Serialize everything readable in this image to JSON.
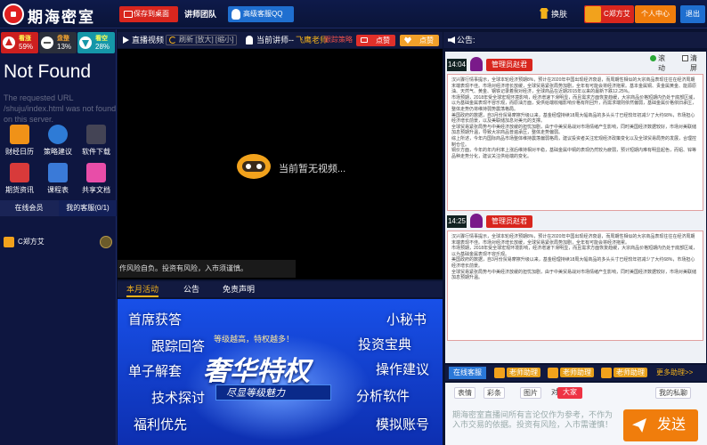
{
  "header": {
    "logo": "期海密室",
    "save_desktop": "保存到桌面",
    "team": "讲师团队",
    "qq_service": "高级客服QQ",
    "skin": "换肤",
    "username": "C郑方艾",
    "user_center": "个人中心",
    "logout": "退出"
  },
  "sidebar": {
    "sentiment": [
      {
        "label": "看涨",
        "pct": "59%"
      },
      {
        "label": "盘整",
        "pct": "13%"
      },
      {
        "label": "看空",
        "pct": "28%"
      }
    ],
    "not_found_title": "Not Found",
    "not_found_text": "The requested URL /shuju/index.html was not found on this server.",
    "tools": [
      "财经日历",
      "策略建议",
      "软件下载",
      "期货资讯",
      "课程表",
      "共享文档"
    ],
    "tabs": {
      "online": "在线会员",
      "my_support": "我的客服(0/1)"
    },
    "members": [
      {
        "name": "C郑方艾"
      }
    ]
  },
  "center": {
    "live_label": "直播视频",
    "refresh": "刷新 [放大] [缩小]",
    "current_lecturer": "当前讲师--",
    "lecturer_name": "飞鹰老师",
    "strategy": "跟踪策略",
    "like": "点赞",
    "favorite": "点赞",
    "no_video": "当前暂无视频...",
    "ticker": "作风险自负。投资有风险，入市须谨慎。",
    "tabs": [
      "本月活动",
      "公告",
      "免责声明"
    ],
    "banner": {
      "words": [
        "首席获答",
        "跟踪回答",
        "单子解套",
        "技术探讨",
        "福利优先",
        "小秘书",
        "投资宝典",
        "操作建议",
        "分析软件",
        "模拟账号"
      ],
      "sub": "等级越高，特权越多！",
      "big": "奢华特权",
      "slogan": "尽显等级魅力"
    }
  },
  "right": {
    "notice_label": "公告:",
    "roll": "滚动",
    "clear": "清屏",
    "messages": [
      {
        "time": "14:04",
        "name": "管理员赵君",
        "p1": "汉兴骤行情事提示，全球本轮经济预期8%，预计在2020年中国出现经济衰退，而周期性相似的大宗商品表现往往在经济周期末端表现不佳。市场对经济增长放缓，全球贸易紧张局势加剧，全年有可能会将经济拖累。基本金属铜、贵金属黄金、能源原油、天然气、黄金、钢铁记录着我对经济，全球商品在近期2015年以来的最新下跌12.25%。",
        "p2": "市场预期，2018年受全球宏观环境影响，经济增速下滑明显，而且需求方面恢复趋缓，大宗商品价格短期内仍处于底部区域，以为基础金属表现不容乐观，而原油方面，受供给端收缩影响价格有所回升，而需求端则依然偏弱，基础金属价格依旧承压，整体走势仍将维持弱势震荡格局。",
        "p3": "美国政府的数据，自3月份贸易摩擦升级以来，基金经理持续18周大幅商品的多头头寸已经较年初减少了大约68%，市场担心经济增长前景，以及美联储加息对美元的支撑。",
        "p4": "全球贸易紧张局势与中美经济放缓的担忧加剧，由于中美贸易战对市场情绪产生影响，同时美国经济数据较好，市场对美联储加息预期升温，导致大宗商品普遍承压，整体走势偏弱。",
        "p5": "综上所述，今年内国际商品市场整体维持震荡偏弱格局，建议投资者关注宏观经济政策变化以及全球贸易局势的发展，合理控制仓位。",
        "p6": "铜价方面，今年的年内利率上涨后维持相对平稳，基础金属中铜的表现仍然较为疲弱，预计短期内难有明显起色，而铝、锌等品种走势分化，建议关注供给端的变化。"
      },
      {
        "time": "14:25",
        "name": "管理员赵君",
        "p1": "汉兴骤行情事提示，全球本轮经济预期8%，预计在2020年中国出现经济衰退，而周期性相似的大宗商品表现往往在经济周期末端表现不佳。市场对经济增长放缓，全球贸易紧张局势加剧，全年有可能会将经济拖累。",
        "p2": "市场预期，2018年受全球宏观环境影响，经济增速下滑明显，而且需求方面恢复趋缓，大宗商品价格短期内仍处于底部区域，以为基础金属表现不容乐观。",
        "p3": "美国政府的数据，自3月份贸易摩擦升级以来，基金经理持续18周大幅商品的多头头寸已经较年初减少了大约68%，市场担心经济增长前景。",
        "p4": "全球贸易紧张局势与中美经济放缓的担忧加剧，由于中美贸易战对市场情绪产生影响，同时美国经济数据较好，市场对美联储加息预期升温。",
        "p5": "",
        "p6": ""
      }
    ],
    "support_label": "在线客服",
    "assistants": [
      "老师助理",
      "老师助理",
      "老师助理"
    ],
    "more": "更多助理>>",
    "toolbar": {
      "emoji": "表情",
      "color": "彩条",
      "image": "图片",
      "to": "对",
      "target": "大家",
      "private": "我的私聊"
    },
    "input_placeholder": "期海密室直播间所有言论仅作为参考，不作为入市交易的依据。投资有风险，入市需谨慎！",
    "send": "发送"
  }
}
